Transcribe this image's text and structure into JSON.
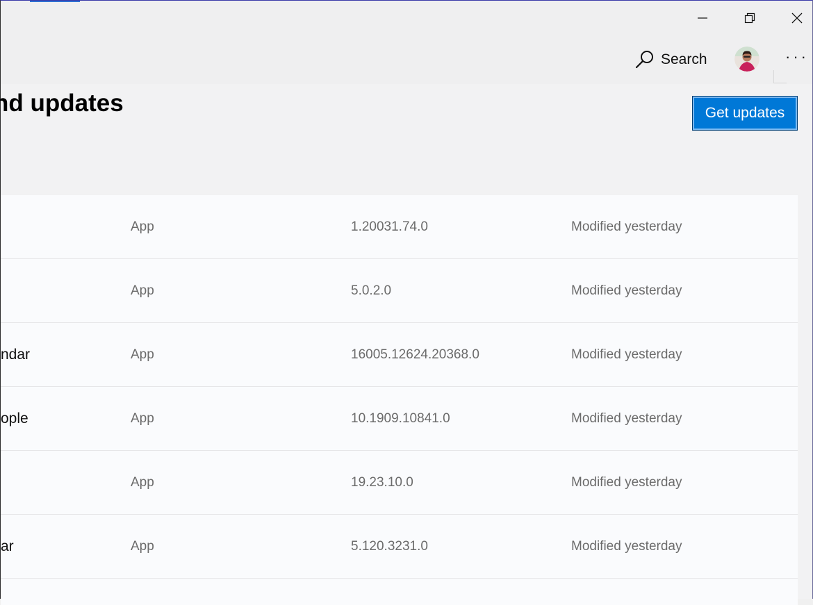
{
  "titlebar": {
    "minimize_icon": "minimize-icon",
    "restore_icon": "restore-icon",
    "close_icon": "close-icon"
  },
  "header": {
    "search_label": "Search",
    "more_label": "···"
  },
  "page": {
    "title": "nd updates",
    "get_updates_label": "Get updates"
  },
  "rows": [
    {
      "name": "",
      "type": "App",
      "version": "1.20031.74.0",
      "modified": "Modified yesterday"
    },
    {
      "name": "",
      "type": "App",
      "version": "5.0.2.0",
      "modified": "Modified yesterday"
    },
    {
      "name": "ndar",
      "type": "App",
      "version": "16005.12624.20368.0",
      "modified": "Modified yesterday"
    },
    {
      "name": "ople",
      "type": "App",
      "version": "10.1909.10841.0",
      "modified": "Modified yesterday"
    },
    {
      "name": "",
      "type": "App",
      "version": "19.23.10.0",
      "modified": "Modified yesterday"
    },
    {
      "name": "ar",
      "type": "App",
      "version": "5.120.3231.0",
      "modified": "Modified yesterday"
    }
  ],
  "colors": {
    "accent": "#0078d7",
    "background": "#f2f2f3",
    "list_background": "#fafbfd",
    "secondary_text": "#6b6b6b"
  }
}
